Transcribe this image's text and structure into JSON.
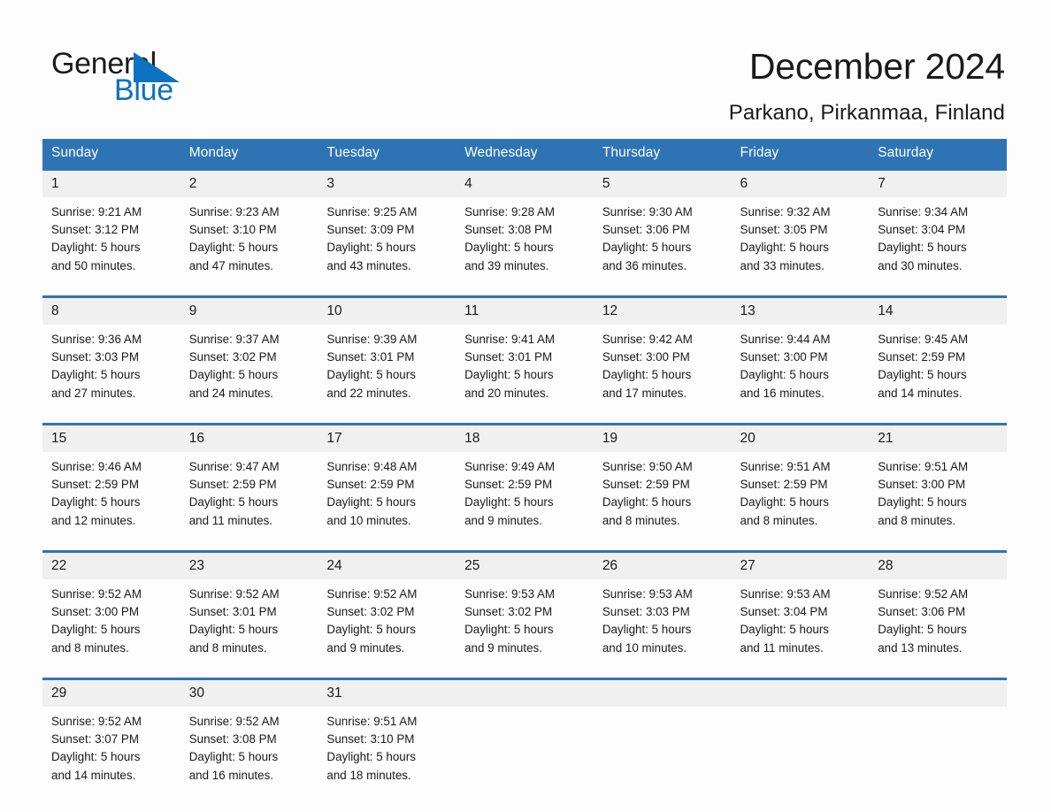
{
  "brand": {
    "name_part1": "General",
    "name_part2": "Blue",
    "triangle_icon": "brand-triangle-icon",
    "accent_color": "#0d72c0"
  },
  "header": {
    "title": "December 2024",
    "location": "Parkano, Pirkanmaa, Finland"
  },
  "theme": {
    "header_blue": "#2e74b5",
    "daynum_band": "#f0f0f0",
    "page_background": "#fdfdfd"
  },
  "weekday_headers": [
    "Sunday",
    "Monday",
    "Tuesday",
    "Wednesday",
    "Thursday",
    "Friday",
    "Saturday"
  ],
  "labels": {
    "sunrise_prefix": "Sunrise:",
    "sunset_prefix": "Sunset:",
    "daylight_prefix": "Daylight:"
  },
  "weeks": [
    [
      {
        "day": "1",
        "sunrise": "Sunrise: 9:21 AM",
        "sunset": "Sunset: 3:12 PM",
        "daylight_line1": "Daylight: 5 hours",
        "daylight_line2": "and 50 minutes."
      },
      {
        "day": "2",
        "sunrise": "Sunrise: 9:23 AM",
        "sunset": "Sunset: 3:10 PM",
        "daylight_line1": "Daylight: 5 hours",
        "daylight_line2": "and 47 minutes."
      },
      {
        "day": "3",
        "sunrise": "Sunrise: 9:25 AM",
        "sunset": "Sunset: 3:09 PM",
        "daylight_line1": "Daylight: 5 hours",
        "daylight_line2": "and 43 minutes."
      },
      {
        "day": "4",
        "sunrise": "Sunrise: 9:28 AM",
        "sunset": "Sunset: 3:08 PM",
        "daylight_line1": "Daylight: 5 hours",
        "daylight_line2": "and 39 minutes."
      },
      {
        "day": "5",
        "sunrise": "Sunrise: 9:30 AM",
        "sunset": "Sunset: 3:06 PM",
        "daylight_line1": "Daylight: 5 hours",
        "daylight_line2": "and 36 minutes."
      },
      {
        "day": "6",
        "sunrise": "Sunrise: 9:32 AM",
        "sunset": "Sunset: 3:05 PM",
        "daylight_line1": "Daylight: 5 hours",
        "daylight_line2": "and 33 minutes."
      },
      {
        "day": "7",
        "sunrise": "Sunrise: 9:34 AM",
        "sunset": "Sunset: 3:04 PM",
        "daylight_line1": "Daylight: 5 hours",
        "daylight_line2": "and 30 minutes."
      }
    ],
    [
      {
        "day": "8",
        "sunrise": "Sunrise: 9:36 AM",
        "sunset": "Sunset: 3:03 PM",
        "daylight_line1": "Daylight: 5 hours",
        "daylight_line2": "and 27 minutes."
      },
      {
        "day": "9",
        "sunrise": "Sunrise: 9:37 AM",
        "sunset": "Sunset: 3:02 PM",
        "daylight_line1": "Daylight: 5 hours",
        "daylight_line2": "and 24 minutes."
      },
      {
        "day": "10",
        "sunrise": "Sunrise: 9:39 AM",
        "sunset": "Sunset: 3:01 PM",
        "daylight_line1": "Daylight: 5 hours",
        "daylight_line2": "and 22 minutes."
      },
      {
        "day": "11",
        "sunrise": "Sunrise: 9:41 AM",
        "sunset": "Sunset: 3:01 PM",
        "daylight_line1": "Daylight: 5 hours",
        "daylight_line2": "and 20 minutes."
      },
      {
        "day": "12",
        "sunrise": "Sunrise: 9:42 AM",
        "sunset": "Sunset: 3:00 PM",
        "daylight_line1": "Daylight: 5 hours",
        "daylight_line2": "and 17 minutes."
      },
      {
        "day": "13",
        "sunrise": "Sunrise: 9:44 AM",
        "sunset": "Sunset: 3:00 PM",
        "daylight_line1": "Daylight: 5 hours",
        "daylight_line2": "and 16 minutes."
      },
      {
        "day": "14",
        "sunrise": "Sunrise: 9:45 AM",
        "sunset": "Sunset: 2:59 PM",
        "daylight_line1": "Daylight: 5 hours",
        "daylight_line2": "and 14 minutes."
      }
    ],
    [
      {
        "day": "15",
        "sunrise": "Sunrise: 9:46 AM",
        "sunset": "Sunset: 2:59 PM",
        "daylight_line1": "Daylight: 5 hours",
        "daylight_line2": "and 12 minutes."
      },
      {
        "day": "16",
        "sunrise": "Sunrise: 9:47 AM",
        "sunset": "Sunset: 2:59 PM",
        "daylight_line1": "Daylight: 5 hours",
        "daylight_line2": "and 11 minutes."
      },
      {
        "day": "17",
        "sunrise": "Sunrise: 9:48 AM",
        "sunset": "Sunset: 2:59 PM",
        "daylight_line1": "Daylight: 5 hours",
        "daylight_line2": "and 10 minutes."
      },
      {
        "day": "18",
        "sunrise": "Sunrise: 9:49 AM",
        "sunset": "Sunset: 2:59 PM",
        "daylight_line1": "Daylight: 5 hours",
        "daylight_line2": "and 9 minutes."
      },
      {
        "day": "19",
        "sunrise": "Sunrise: 9:50 AM",
        "sunset": "Sunset: 2:59 PM",
        "daylight_line1": "Daylight: 5 hours",
        "daylight_line2": "and 8 minutes."
      },
      {
        "day": "20",
        "sunrise": "Sunrise: 9:51 AM",
        "sunset": "Sunset: 2:59 PM",
        "daylight_line1": "Daylight: 5 hours",
        "daylight_line2": "and 8 minutes."
      },
      {
        "day": "21",
        "sunrise": "Sunrise: 9:51 AM",
        "sunset": "Sunset: 3:00 PM",
        "daylight_line1": "Daylight: 5 hours",
        "daylight_line2": "and 8 minutes."
      }
    ],
    [
      {
        "day": "22",
        "sunrise": "Sunrise: 9:52 AM",
        "sunset": "Sunset: 3:00 PM",
        "daylight_line1": "Daylight: 5 hours",
        "daylight_line2": "and 8 minutes."
      },
      {
        "day": "23",
        "sunrise": "Sunrise: 9:52 AM",
        "sunset": "Sunset: 3:01 PM",
        "daylight_line1": "Daylight: 5 hours",
        "daylight_line2": "and 8 minutes."
      },
      {
        "day": "24",
        "sunrise": "Sunrise: 9:52 AM",
        "sunset": "Sunset: 3:02 PM",
        "daylight_line1": "Daylight: 5 hours",
        "daylight_line2": "and 9 minutes."
      },
      {
        "day": "25",
        "sunrise": "Sunrise: 9:53 AM",
        "sunset": "Sunset: 3:02 PM",
        "daylight_line1": "Daylight: 5 hours",
        "daylight_line2": "and 9 minutes."
      },
      {
        "day": "26",
        "sunrise": "Sunrise: 9:53 AM",
        "sunset": "Sunset: 3:03 PM",
        "daylight_line1": "Daylight: 5 hours",
        "daylight_line2": "and 10 minutes."
      },
      {
        "day": "27",
        "sunrise": "Sunrise: 9:53 AM",
        "sunset": "Sunset: 3:04 PM",
        "daylight_line1": "Daylight: 5 hours",
        "daylight_line2": "and 11 minutes."
      },
      {
        "day": "28",
        "sunrise": "Sunrise: 9:52 AM",
        "sunset": "Sunset: 3:06 PM",
        "daylight_line1": "Daylight: 5 hours",
        "daylight_line2": "and 13 minutes."
      }
    ],
    [
      {
        "day": "29",
        "sunrise": "Sunrise: 9:52 AM",
        "sunset": "Sunset: 3:07 PM",
        "daylight_line1": "Daylight: 5 hours",
        "daylight_line2": "and 14 minutes."
      },
      {
        "day": "30",
        "sunrise": "Sunrise: 9:52 AM",
        "sunset": "Sunset: 3:08 PM",
        "daylight_line1": "Daylight: 5 hours",
        "daylight_line2": "and 16 minutes."
      },
      {
        "day": "31",
        "sunrise": "Sunrise: 9:51 AM",
        "sunset": "Sunset: 3:10 PM",
        "daylight_line1": "Daylight: 5 hours",
        "daylight_line2": "and 18 minutes."
      },
      {
        "day": "",
        "sunrise": "",
        "sunset": "",
        "daylight_line1": "",
        "daylight_line2": ""
      },
      {
        "day": "",
        "sunrise": "",
        "sunset": "",
        "daylight_line1": "",
        "daylight_line2": ""
      },
      {
        "day": "",
        "sunrise": "",
        "sunset": "",
        "daylight_line1": "",
        "daylight_line2": ""
      },
      {
        "day": "",
        "sunrise": "",
        "sunset": "",
        "daylight_line1": "",
        "daylight_line2": ""
      }
    ]
  ]
}
